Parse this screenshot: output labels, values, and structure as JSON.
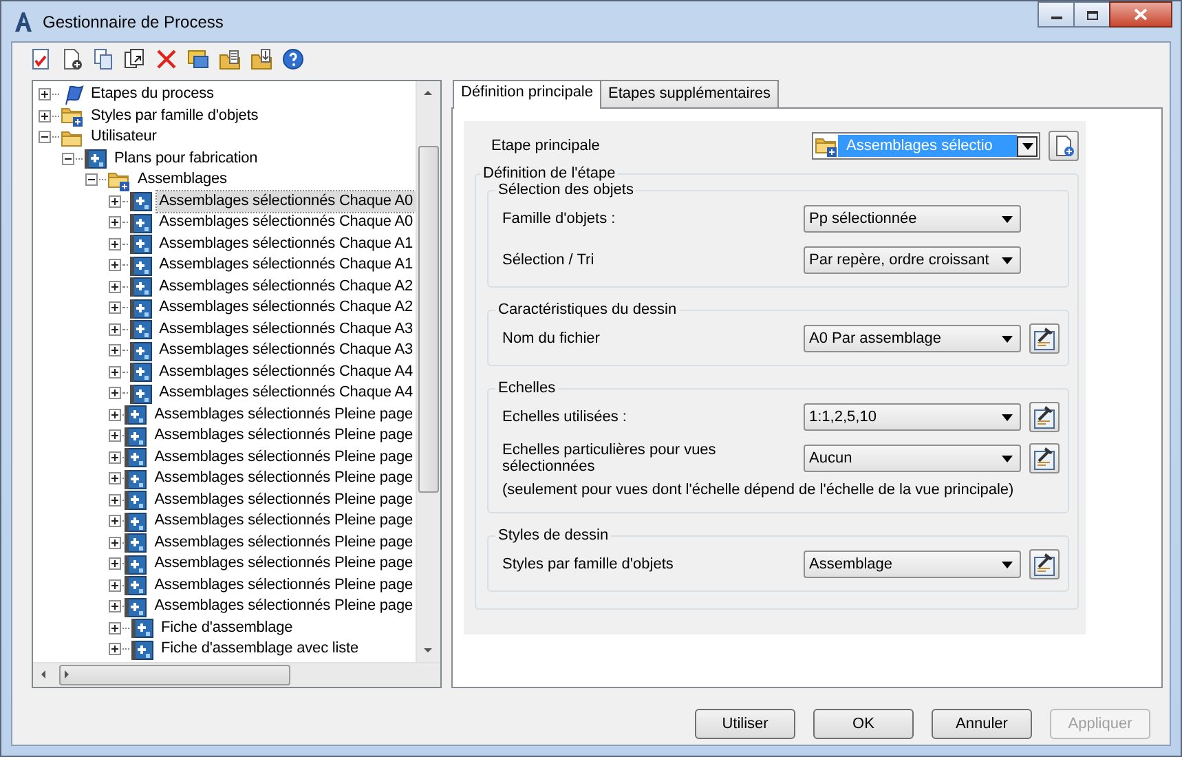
{
  "window": {
    "title": "Gestionnaire de Process"
  },
  "tree": {
    "items": [
      {
        "children": [
          {
            "label": "Etapes du process",
            "kind": "steps",
            "expanded": false,
            "selected": false
          },
          {
            "label": "Styles par famille d'objets",
            "kind": "group",
            "expanded": false,
            "selected": false
          }
        ]
      },
      {
        "label": "Utilisateur",
        "kind": "folder",
        "expanded": true,
        "selected": false,
        "children": [
          {
            "label": "Plans pour fabrication",
            "kind": "plan",
            "expanded": true,
            "selected": false,
            "children": [
              {
                "label": "Assemblages",
                "kind": "group",
                "expanded": true,
                "selected": false,
                "children": [
                  {
                    "label": "Assemblages sélectionnés Chaque A0",
                    "kind": "plan",
                    "expanded": false,
                    "selected": true
                  },
                  {
                    "label": "Assemblages sélectionnés Chaque A0",
                    "kind": "plan",
                    "expanded": false,
                    "selected": false
                  },
                  {
                    "label": "Assemblages sélectionnés Chaque A1",
                    "kind": "plan",
                    "expanded": false,
                    "selected": false
                  },
                  {
                    "label": "Assemblages sélectionnés Chaque A1",
                    "kind": "plan",
                    "expanded": false,
                    "selected": false
                  },
                  {
                    "label": "Assemblages sélectionnés Chaque A2",
                    "kind": "plan",
                    "expanded": false,
                    "selected": false
                  },
                  {
                    "label": "Assemblages sélectionnés Chaque A2",
                    "kind": "plan",
                    "expanded": false,
                    "selected": false
                  },
                  {
                    "label": "Assemblages sélectionnés Chaque A3",
                    "kind": "plan",
                    "expanded": false,
                    "selected": false
                  },
                  {
                    "label": "Assemblages sélectionnés Chaque A3",
                    "kind": "plan",
                    "expanded": false,
                    "selected": false
                  },
                  {
                    "label": "Assemblages sélectionnés Chaque A4",
                    "kind": "plan",
                    "expanded": false,
                    "selected": false
                  },
                  {
                    "label": "Assemblages sélectionnés Chaque A4",
                    "kind": "plan",
                    "expanded": false,
                    "selected": false
                  },
                  {
                    "label": "Assemblages sélectionnés Pleine page",
                    "kind": "plan",
                    "expanded": false,
                    "selected": false
                  },
                  {
                    "label": "Assemblages sélectionnés Pleine page",
                    "kind": "plan",
                    "expanded": false,
                    "selected": false
                  },
                  {
                    "label": "Assemblages sélectionnés Pleine page",
                    "kind": "plan",
                    "expanded": false,
                    "selected": false
                  },
                  {
                    "label": "Assemblages sélectionnés Pleine page",
                    "kind": "plan",
                    "expanded": false,
                    "selected": false
                  },
                  {
                    "label": "Assemblages sélectionnés Pleine page",
                    "kind": "plan",
                    "expanded": false,
                    "selected": false
                  },
                  {
                    "label": "Assemblages sélectionnés Pleine page",
                    "kind": "plan",
                    "expanded": false,
                    "selected": false
                  },
                  {
                    "label": "Assemblages sélectionnés Pleine page",
                    "kind": "plan",
                    "expanded": false,
                    "selected": false
                  },
                  {
                    "label": "Assemblages sélectionnés Pleine page",
                    "kind": "plan",
                    "expanded": false,
                    "selected": false
                  },
                  {
                    "label": "Assemblages sélectionnés Pleine page",
                    "kind": "plan",
                    "expanded": false,
                    "selected": false
                  },
                  {
                    "label": "Assemblages sélectionnés Pleine page",
                    "kind": "plan",
                    "expanded": false,
                    "selected": false
                  },
                  {
                    "label": "Fiche d'assemblage",
                    "kind": "plan",
                    "expanded": false,
                    "selected": false
                  },
                  {
                    "label": "Fiche d'assemblage avec liste",
                    "kind": "plan",
                    "expanded": false,
                    "selected": false
                  }
                ]
              }
            ]
          }
        ]
      }
    ]
  },
  "tabs": [
    {
      "label": "Définition principale",
      "selected": true
    },
    {
      "label": "Etapes supplémentaires",
      "selected": false
    }
  ],
  "main_step": {
    "label": "Etape principale",
    "value": "Assemblages sélectio",
    "focused": true
  },
  "definition": {
    "title": "Définition de l'étape",
    "groups": [
      {
        "title": "Sélection des objets",
        "rows": [
          {
            "kind": "combo",
            "label": "Famille d'objets :",
            "value": "Pp sélectionnée",
            "edit_button": false
          },
          {
            "kind": "combo",
            "label": "Sélection / Tri",
            "value": "Par repère, ordre croissant",
            "edit_button": false
          }
        ]
      },
      {
        "title": "Caractéristiques du dessin",
        "rows": [
          {
            "kind": "combo",
            "label": "Nom du fichier",
            "value": "A0 Par assemblage",
            "edit_button": true
          }
        ]
      },
      {
        "title": "Echelles",
        "rows": [
          {
            "kind": "combo",
            "label": "Echelles utilisées :",
            "value": "1:1,2,5,10",
            "edit_button": true
          },
          {
            "kind": "combo",
            "label": "Echelles particulières pour vues sélectionnées",
            "value": "Aucun",
            "edit_button": true
          },
          {
            "kind": "note",
            "label": "(seulement pour vues dont l'échelle dépend de l'échelle de la vue principale)"
          }
        ]
      },
      {
        "title": "Styles de dessin",
        "rows": [
          {
            "kind": "combo",
            "label": "Styles par famille d'objets",
            "value": "Assemblage",
            "edit_button": true
          }
        ]
      }
    ]
  },
  "buttons": [
    {
      "label": "Utiliser",
      "disabled": false
    },
    {
      "label": "OK",
      "disabled": false
    },
    {
      "label": "Annuler",
      "disabled": false
    },
    {
      "label": "Appliquer",
      "disabled": true
    }
  ]
}
